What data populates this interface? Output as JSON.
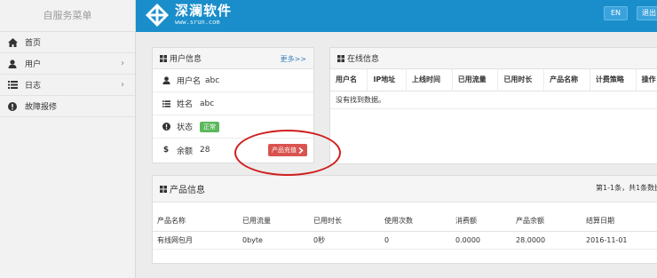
{
  "sidebar": {
    "title": "自服务菜单",
    "items": [
      {
        "label": "首页",
        "icon": "home-icon",
        "chevron": ""
      },
      {
        "label": "用户",
        "icon": "user-icon",
        "chevron": "›"
      },
      {
        "label": "日志",
        "icon": "list-icon",
        "chevron": "›"
      },
      {
        "label": "故障报修",
        "icon": "info-circle-icon",
        "chevron": ""
      }
    ]
  },
  "header": {
    "brand_name": "深澜软件",
    "brand_url": "www.srun.com",
    "lang_button": "EN",
    "logout_button": "退出"
  },
  "user_info": {
    "title": "用户信息",
    "more": "更多>>",
    "username_label": "用户名",
    "username_value": "abc",
    "name_label": "姓名",
    "name_value": "abc",
    "status_label": "状态",
    "status_value": "正常",
    "balance_label": "余额",
    "balance_value": "28",
    "recharge_button": "产品充值"
  },
  "online_info": {
    "title": "在线信息",
    "columns": [
      "用户名",
      "IP地址",
      "上线时间",
      "已用流量",
      "已用时长",
      "产品名称",
      "计费策略",
      "操作"
    ],
    "empty_text": "没有找到数据。"
  },
  "product_info": {
    "title": "产品信息",
    "pager": "第1-1条，共1条数据",
    "columns": [
      "产品名称",
      "已用流量",
      "已用时长",
      "使用次数",
      "消费额",
      "产品余额",
      "结算日期"
    ],
    "rows": [
      [
        "有线网包月",
        "0byte",
        "0秒",
        "0",
        "0.0000",
        "28.0000",
        "2016-11-01"
      ]
    ]
  },
  "colors": {
    "topbar": "#1a8ecb",
    "status_ok": "#5cb85c",
    "recharge": "#d9534f",
    "annotation": "#d02020"
  }
}
